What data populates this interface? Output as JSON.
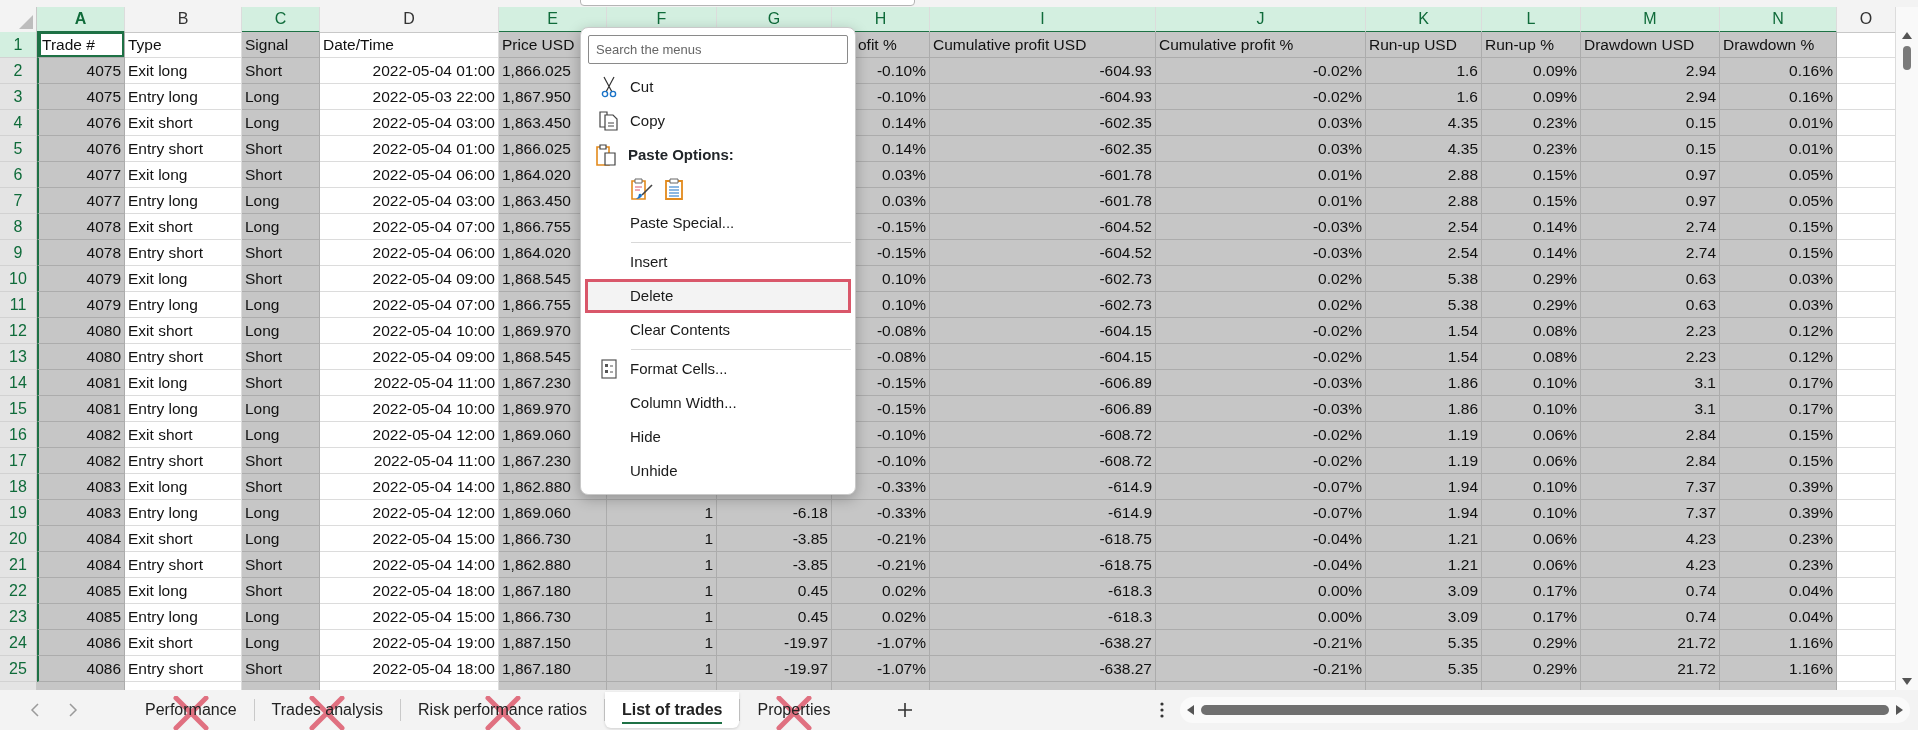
{
  "sheet": {
    "columns": [
      {
        "letter": "A",
        "selected": true,
        "active": true,
        "kind": "number"
      },
      {
        "letter": "B",
        "selected": false,
        "active": false,
        "kind": "text"
      },
      {
        "letter": "C",
        "selected": true,
        "active": false,
        "kind": "text"
      },
      {
        "letter": "D",
        "selected": false,
        "active": false,
        "kind": "number"
      },
      {
        "letter": "E",
        "selected": true,
        "active": false,
        "kind": "text"
      },
      {
        "letter": "F",
        "selected": true,
        "active": false,
        "kind": "number"
      },
      {
        "letter": "G",
        "selected": true,
        "active": false,
        "kind": "number"
      },
      {
        "letter": "H",
        "selected": true,
        "active": false,
        "kind": "number"
      },
      {
        "letter": "I",
        "selected": true,
        "active": false,
        "kind": "number"
      },
      {
        "letter": "J",
        "selected": true,
        "active": false,
        "kind": "number"
      },
      {
        "letter": "K",
        "selected": true,
        "active": false,
        "kind": "number"
      },
      {
        "letter": "L",
        "selected": true,
        "active": false,
        "kind": "number"
      },
      {
        "letter": "M",
        "selected": true,
        "active": false,
        "kind": "number"
      },
      {
        "letter": "N",
        "selected": true,
        "active": false,
        "kind": "number"
      },
      {
        "letter": "O",
        "selected": false,
        "active": false,
        "kind": "text"
      }
    ],
    "rows": [
      {
        "number": "1",
        "kind": "header",
        "active": true,
        "cells": [
          "Trade #",
          "Type",
          "Signal",
          "Date/Time",
          "Price USD",
          null,
          null,
          "ofit %",
          "Cumulative profit USD",
          "Cumulative profit %",
          "Run-up USD",
          "Run-up %",
          "Drawdown USD",
          "Drawdown %"
        ]
      },
      {
        "number": "2",
        "kind": "data",
        "active": false,
        "cells": [
          "4075",
          "Exit long",
          "Short",
          "2022-05-04 01:00",
          "1,866.025",
          null,
          null,
          "-0.10%",
          "-604.93",
          "-0.02%",
          "1.6",
          "0.09%",
          "2.94",
          "0.16%"
        ]
      },
      {
        "number": "3",
        "kind": "data",
        "active": false,
        "cells": [
          "4075",
          "Entry long",
          "Long",
          "2022-05-03 22:00",
          "1,867.950",
          null,
          null,
          "-0.10%",
          "-604.93",
          "-0.02%",
          "1.6",
          "0.09%",
          "2.94",
          "0.16%"
        ]
      },
      {
        "number": "4",
        "kind": "data",
        "active": false,
        "cells": [
          "4076",
          "Exit short",
          "Long",
          "2022-05-04 03:00",
          "1,863.450",
          null,
          null,
          "0.14%",
          "-602.35",
          "0.03%",
          "4.35",
          "0.23%",
          "0.15",
          "0.01%"
        ]
      },
      {
        "number": "5",
        "kind": "data",
        "active": false,
        "cells": [
          "4076",
          "Entry short",
          "Short",
          "2022-05-04 01:00",
          "1,866.025",
          null,
          null,
          "0.14%",
          "-602.35",
          "0.03%",
          "4.35",
          "0.23%",
          "0.15",
          "0.01%"
        ]
      },
      {
        "number": "6",
        "kind": "data",
        "active": false,
        "cells": [
          "4077",
          "Exit long",
          "Short",
          "2022-05-04 06:00",
          "1,864.020",
          null,
          null,
          "0.03%",
          "-601.78",
          "0.01%",
          "2.88",
          "0.15%",
          "0.97",
          "0.05%"
        ]
      },
      {
        "number": "7",
        "kind": "data",
        "active": false,
        "cells": [
          "4077",
          "Entry long",
          "Long",
          "2022-05-04 03:00",
          "1,863.450",
          null,
          null,
          "0.03%",
          "-601.78",
          "0.01%",
          "2.88",
          "0.15%",
          "0.97",
          "0.05%"
        ]
      },
      {
        "number": "8",
        "kind": "data",
        "active": false,
        "cells": [
          "4078",
          "Exit short",
          "Long",
          "2022-05-04 07:00",
          "1,866.755",
          null,
          null,
          "-0.15%",
          "-604.52",
          "-0.03%",
          "2.54",
          "0.14%",
          "2.74",
          "0.15%"
        ]
      },
      {
        "number": "9",
        "kind": "data",
        "active": false,
        "cells": [
          "4078",
          "Entry short",
          "Short",
          "2022-05-04 06:00",
          "1,864.020",
          null,
          null,
          "-0.15%",
          "-604.52",
          "-0.03%",
          "2.54",
          "0.14%",
          "2.74",
          "0.15%"
        ]
      },
      {
        "number": "10",
        "kind": "data",
        "active": false,
        "cells": [
          "4079",
          "Exit long",
          "Short",
          "2022-05-04 09:00",
          "1,868.545",
          null,
          null,
          "0.10%",
          "-602.73",
          "0.02%",
          "5.38",
          "0.29%",
          "0.63",
          "0.03%"
        ]
      },
      {
        "number": "11",
        "kind": "data",
        "active": false,
        "cells": [
          "4079",
          "Entry long",
          "Long",
          "2022-05-04 07:00",
          "1,866.755",
          null,
          null,
          "0.10%",
          "-602.73",
          "0.02%",
          "5.38",
          "0.29%",
          "0.63",
          "0.03%"
        ]
      },
      {
        "number": "12",
        "kind": "data",
        "active": false,
        "cells": [
          "4080",
          "Exit short",
          "Long",
          "2022-05-04 10:00",
          "1,869.970",
          null,
          null,
          "-0.08%",
          "-604.15",
          "-0.02%",
          "1.54",
          "0.08%",
          "2.23",
          "0.12%"
        ]
      },
      {
        "number": "13",
        "kind": "data",
        "active": false,
        "cells": [
          "4080",
          "Entry short",
          "Short",
          "2022-05-04 09:00",
          "1,868.545",
          null,
          null,
          "-0.08%",
          "-604.15",
          "-0.02%",
          "1.54",
          "0.08%",
          "2.23",
          "0.12%"
        ]
      },
      {
        "number": "14",
        "kind": "data",
        "active": false,
        "cells": [
          "4081",
          "Exit long",
          "Short",
          "2022-05-04 11:00",
          "1,867.230",
          null,
          null,
          "-0.15%",
          "-606.89",
          "-0.03%",
          "1.86",
          "0.10%",
          "3.1",
          "0.17%"
        ]
      },
      {
        "number": "15",
        "kind": "data",
        "active": false,
        "cells": [
          "4081",
          "Entry long",
          "Long",
          "2022-05-04 10:00",
          "1,869.970",
          null,
          null,
          "-0.15%",
          "-606.89",
          "-0.03%",
          "1.86",
          "0.10%",
          "3.1",
          "0.17%"
        ]
      },
      {
        "number": "16",
        "kind": "data",
        "active": false,
        "cells": [
          "4082",
          "Exit short",
          "Long",
          "2022-05-04 12:00",
          "1,869.060",
          null,
          null,
          "-0.10%",
          "-608.72",
          "-0.02%",
          "1.19",
          "0.06%",
          "2.84",
          "0.15%"
        ]
      },
      {
        "number": "17",
        "kind": "data",
        "active": false,
        "cells": [
          "4082",
          "Entry short",
          "Short",
          "2022-05-04 11:00",
          "1,867.230",
          null,
          null,
          "-0.10%",
          "-608.72",
          "-0.02%",
          "1.19",
          "0.06%",
          "2.84",
          "0.15%"
        ]
      },
      {
        "number": "18",
        "kind": "data",
        "active": false,
        "cells": [
          "4083",
          "Exit long",
          "Short",
          "2022-05-04 14:00",
          "1,862.880",
          null,
          null,
          "-0.33%",
          "-614.9",
          "-0.07%",
          "1.94",
          "0.10%",
          "7.37",
          "0.39%"
        ]
      },
      {
        "number": "19",
        "kind": "data",
        "active": false,
        "cells": [
          "4083",
          "Entry long",
          "Long",
          "2022-05-04 12:00",
          "1,869.060",
          "1",
          "-6.18",
          "-0.33%",
          "-614.9",
          "-0.07%",
          "1.94",
          "0.10%",
          "7.37",
          "0.39%"
        ]
      },
      {
        "number": "20",
        "kind": "data",
        "active": false,
        "cells": [
          "4084",
          "Exit short",
          "Long",
          "2022-05-04 15:00",
          "1,866.730",
          "1",
          "-3.85",
          "-0.21%",
          "-618.75",
          "-0.04%",
          "1.21",
          "0.06%",
          "4.23",
          "0.23%"
        ]
      },
      {
        "number": "21",
        "kind": "data",
        "active": false,
        "cells": [
          "4084",
          "Entry short",
          "Short",
          "2022-05-04 14:00",
          "1,862.880",
          "1",
          "-3.85",
          "-0.21%",
          "-618.75",
          "-0.04%",
          "1.21",
          "0.06%",
          "4.23",
          "0.23%"
        ]
      },
      {
        "number": "22",
        "kind": "data",
        "active": false,
        "cells": [
          "4085",
          "Exit long",
          "Short",
          "2022-05-04 18:00",
          "1,867.180",
          "1",
          "0.45",
          "0.02%",
          "-618.3",
          "0.00%",
          "3.09",
          "0.17%",
          "0.74",
          "0.04%"
        ]
      },
      {
        "number": "23",
        "kind": "data",
        "active": false,
        "cells": [
          "4085",
          "Entry long",
          "Long",
          "2022-05-04 15:00",
          "1,866.730",
          "1",
          "0.45",
          "0.02%",
          "-618.3",
          "0.00%",
          "3.09",
          "0.17%",
          "0.74",
          "0.04%"
        ]
      },
      {
        "number": "24",
        "kind": "data",
        "active": false,
        "cells": [
          "4086",
          "Exit short",
          "Long",
          "2022-05-04 19:00",
          "1,887.150",
          "1",
          "-19.97",
          "-1.07%",
          "-638.27",
          "-0.21%",
          "5.35",
          "0.29%",
          "21.72",
          "1.16%"
        ]
      },
      {
        "number": "25",
        "kind": "data",
        "active": false,
        "cells": [
          "4086",
          "Entry short",
          "Short",
          "2022-05-04 18:00",
          "1,867.180",
          "1",
          "-19.97",
          "-1.07%",
          "-638.27",
          "-0.21%",
          "5.35",
          "0.29%",
          "21.72",
          "1.16%"
        ]
      }
    ]
  },
  "context_menu": {
    "items": [
      {
        "kind": "search",
        "placeholder": "Search the menus"
      },
      {
        "kind": "cut",
        "label": "Cut",
        "highlighted": false
      },
      {
        "kind": "copy",
        "label": "Copy",
        "highlighted": false
      },
      {
        "kind": "paste",
        "label": "Paste Options:"
      },
      {
        "kind": "pasteicons"
      },
      {
        "kind": "plain",
        "label": "Paste Special...",
        "highlighted": false
      },
      {
        "kind": "separator"
      },
      {
        "kind": "plain",
        "label": "Insert",
        "highlighted": false
      },
      {
        "kind": "plain",
        "label": "Delete",
        "highlighted": true
      },
      {
        "kind": "plain",
        "label": "Clear Contents",
        "highlighted": false
      },
      {
        "kind": "separator"
      },
      {
        "kind": "format",
        "label": "Format Cells...",
        "highlighted": false
      },
      {
        "kind": "plain",
        "label": "Column Width...",
        "highlighted": false
      },
      {
        "kind": "plain",
        "label": "Hide",
        "highlighted": false
      },
      {
        "kind": "plain",
        "label": "Unhide",
        "highlighted": false
      }
    ]
  },
  "sheet_tabs": [
    {
      "label": "Performance",
      "selected": false,
      "crossed": true
    },
    {
      "label": "Trades analysis",
      "selected": false,
      "crossed": true
    },
    {
      "label": "Risk performance ratios",
      "selected": false,
      "crossed": true
    },
    {
      "label": "List of trades",
      "selected": true,
      "crossed": false
    },
    {
      "label": "Properties",
      "selected": false,
      "crossed": true
    }
  ]
}
